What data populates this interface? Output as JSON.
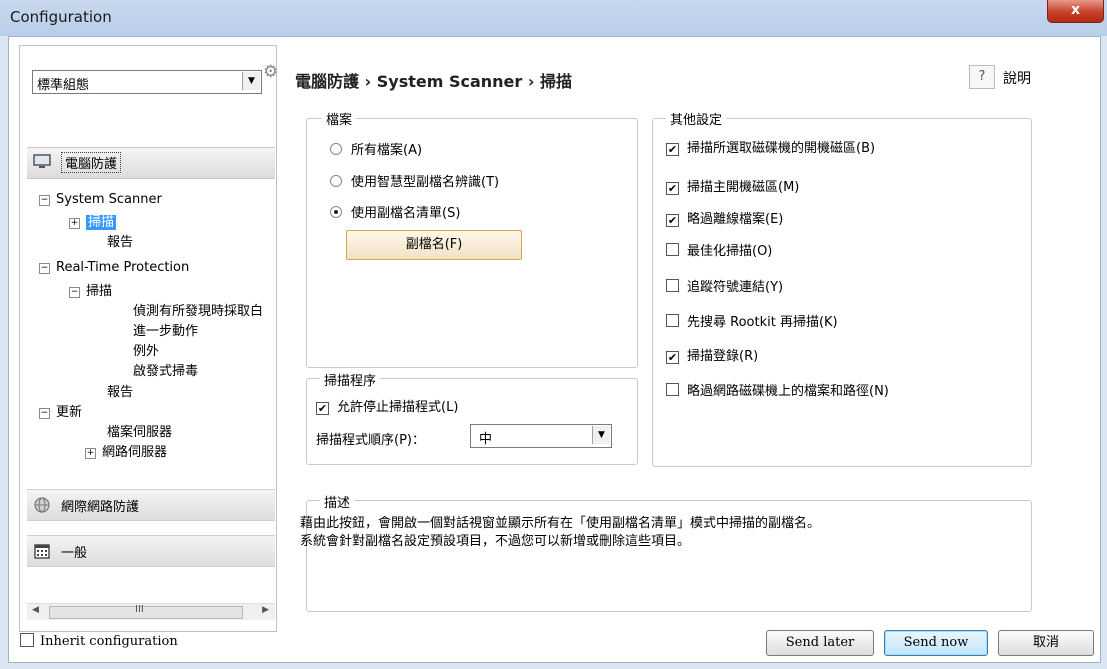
{
  "window": {
    "title": "Configuration",
    "close_label": "x"
  },
  "left": {
    "profile_value": "標準組態",
    "categories": [
      {
        "label": "電腦防護",
        "icon": "monitor-icon"
      },
      {
        "label": "網際網路防護",
        "icon": "globe-icon"
      },
      {
        "label": "一般",
        "icon": "calendar-icon"
      }
    ],
    "tree": {
      "system_scanner": "System Scanner",
      "scan": "掃描",
      "report": "報告",
      "realtime": "Real-Time Protection",
      "rt_scan": "掃描",
      "rt_detect": "偵測有所發現時採取白",
      "rt_further": "進一步動作",
      "rt_exceptions": "例外",
      "rt_heuristic": "啟發式掃毒",
      "rt_report": "報告",
      "update": "更新",
      "file_server": "檔案伺服器",
      "web_server": "網路伺服器"
    },
    "scroll_grip": "III"
  },
  "header": {
    "breadcrumb": "電腦防護 › System Scanner › 掃描",
    "help_icon": "?",
    "help_label": "說明"
  },
  "files": {
    "legend": "檔案",
    "options": [
      "所有檔案(A)",
      "使用智慧型副檔名辨識(T)",
      "使用副檔名清單(S)"
    ],
    "selected": 2,
    "ext_button": "副檔名(F)"
  },
  "process": {
    "legend": "掃描程序",
    "allow_stop": "允許停止掃描程式(L)",
    "allow_stop_checked": true,
    "priority_label": "掃描程式順序(P)：",
    "priority_value": "中"
  },
  "other": {
    "legend": "其他設定",
    "items": [
      {
        "label": "掃描所選取磁碟機的開機磁區(B)",
        "checked": true
      },
      {
        "label": "掃描主開機磁區(M)",
        "checked": true
      },
      {
        "label": "略過離線檔案(E)",
        "checked": true
      },
      {
        "label": "最佳化掃描(O)",
        "checked": false
      },
      {
        "label": "追蹤符號連結(Y)",
        "checked": false
      },
      {
        "label": "先搜尋 Rootkit 再掃描(K)",
        "checked": false
      },
      {
        "label": "掃描登錄(R)",
        "checked": true
      },
      {
        "label": "略過網路磁碟機上的檔案和路徑(N)",
        "checked": false
      }
    ]
  },
  "description": {
    "legend": "描述",
    "line1": "藉由此按鈕，會開啟一個對話視窗並顯示所有在「使用副檔名清單」模式中掃描的副檔名。",
    "line2": "系統會針對副檔名設定預設項目，不過您可以新增或刪除這些項目。"
  },
  "footer": {
    "inherit_label": "Inherit configuration",
    "send_later": "Send later",
    "send_now": "Send now",
    "cancel": "取消"
  }
}
